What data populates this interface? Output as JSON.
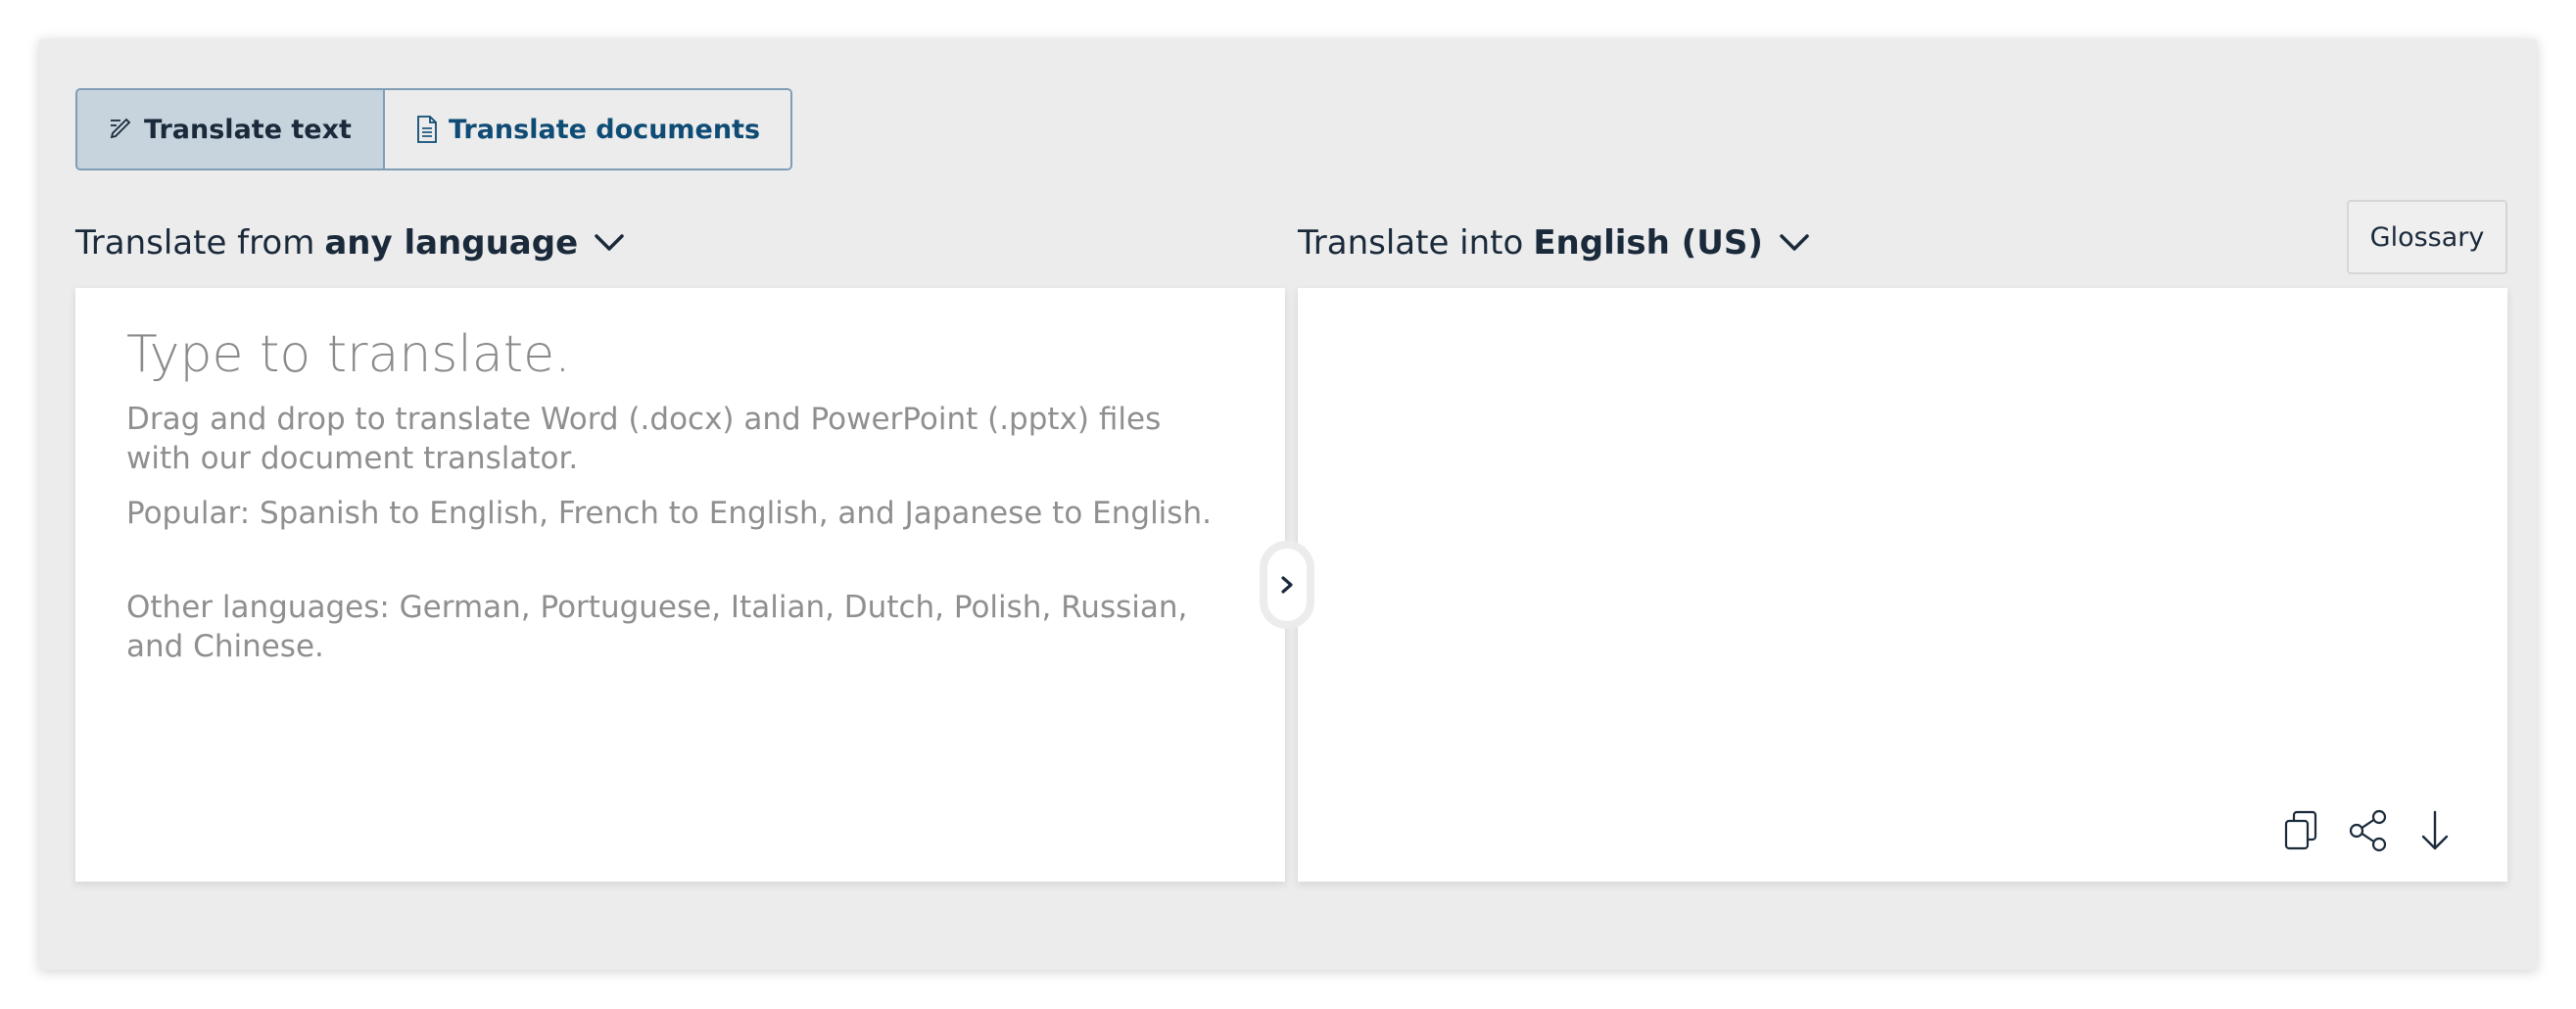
{
  "tabs": [
    {
      "label": "Translate text",
      "icon": "pen-edit-icon",
      "selected": true
    },
    {
      "label": "Translate documents",
      "icon": "document-icon",
      "selected": false
    }
  ],
  "source": {
    "prefix": "Translate from",
    "language": "any language",
    "placeholder_title": "Type to translate.",
    "hints": [
      "Drag and drop to translate Word (.docx) and PowerPoint (.pptx) files with our document translator.",
      "Popular: Spanish to English, French to English, and Japanese to English.",
      "Other languages: German, Portuguese, Italian, Dutch, Polish, Russian, and Chinese."
    ]
  },
  "target": {
    "prefix": "Translate into",
    "language": "English (US)"
  },
  "glossary_label": "Glossary",
  "actions": [
    "copy-icon",
    "share-icon",
    "download-icon"
  ],
  "colors": {
    "accent": "#0f4c75",
    "selected_tab_bg": "#c7d4de",
    "frame_bg": "#ececec",
    "text_dark": "#1b2a3b",
    "placeholder": "#8a8a8a"
  }
}
